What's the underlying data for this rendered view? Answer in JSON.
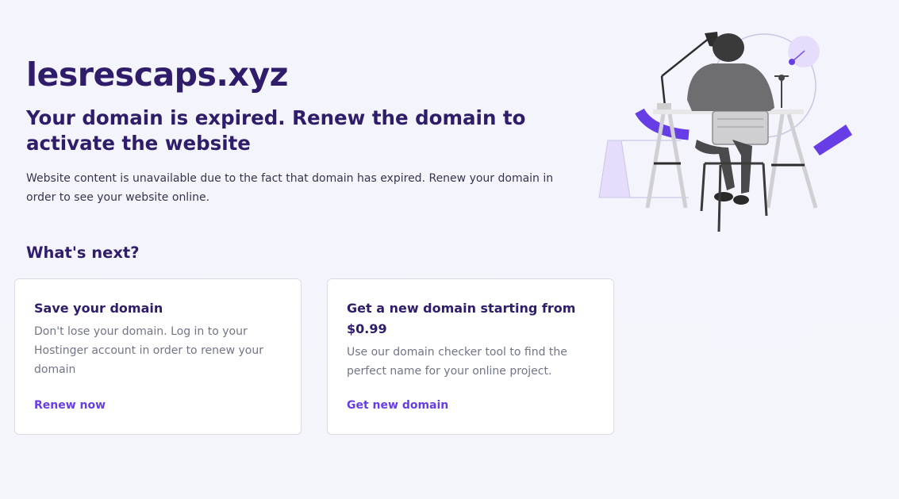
{
  "domain": "lesrescaps.xyz",
  "headline": "Your domain is expired. Renew the domain to activate the website",
  "description": "Website content is unavailable due to the fact that domain has expired. Renew your domain in order to see your website online.",
  "next_section": {
    "title": "What's next?",
    "cards": [
      {
        "title": "Save your domain",
        "text": "Don't lose your domain. Log in to your Hostinger account in order to renew your domain",
        "link": "Renew now"
      },
      {
        "title": "Get a new domain starting from $0.99",
        "text": "Use our domain checker tool to find the perfect name for your online project.",
        "link": "Get new domain"
      }
    ]
  },
  "colors": {
    "heading": "#2f1c6a",
    "accent": "#673de6",
    "body_text": "#36344d",
    "muted_text": "#727586",
    "background": "#f4f5fc"
  },
  "illustration": {
    "icon": "person-working-at-desk-illustration"
  }
}
